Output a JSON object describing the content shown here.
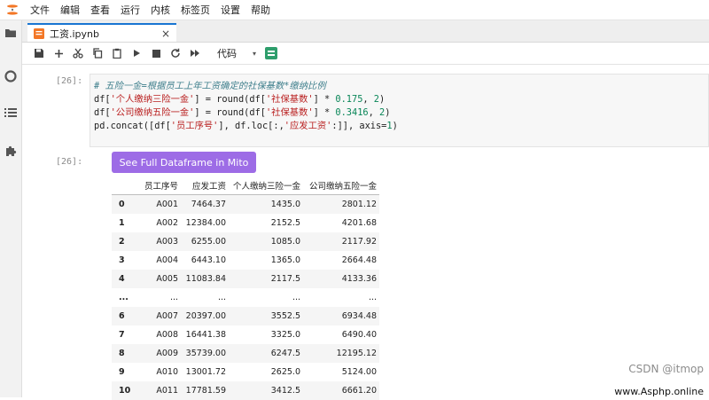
{
  "menu": [
    "文件",
    "编辑",
    "查看",
    "运行",
    "内核",
    "标签页",
    "设置",
    "帮助"
  ],
  "tab": {
    "label": "工资.ipynb",
    "close": "×"
  },
  "toolbar": {
    "cell_type": "代码",
    "caret": "▾"
  },
  "cells": {
    "code_prompt": "[26]:",
    "code_lines": {
      "l1": "# 五险一金=根据员工上年工资确定的社保基数*缴纳比例",
      "l2_a": "df[",
      "l2_s": "'个人缴纳三险一金'",
      "l2_b": "] = round(df[",
      "l2_s2": "'社保基数'",
      "l2_c": "] * ",
      "l2_n": "0.175",
      "l2_d": ", ",
      "l2_n2": "2",
      "l2_e": ")",
      "l3_a": "df[",
      "l3_s": "'公司缴纳五险一金'",
      "l3_b": "] = round(df[",
      "l3_s2": "'社保基数'",
      "l3_c": "] * ",
      "l3_n": "0.3416",
      "l3_d": ", ",
      "l3_n2": "2",
      "l3_e": ")",
      "l4_a": "pd.concat([df[",
      "l4_s": "'员工序号'",
      "l4_b": "], df.loc[:,",
      "l4_s2": "'应发工资'",
      "l4_c": ":]], axis=",
      "l4_n": "1",
      "l4_d": ")"
    },
    "output_prompt": "[26]:",
    "mito_button": "See Full Dataframe in Mito"
  },
  "table": {
    "headers": [
      "",
      "员工序号",
      "应发工资",
      "个人缴纳三险一金",
      "公司缴纳五险一金"
    ],
    "rows": [
      [
        "0",
        "A001",
        "7464.37",
        "1435.0",
        "2801.12"
      ],
      [
        "1",
        "A002",
        "12384.00",
        "2152.5",
        "4201.68"
      ],
      [
        "2",
        "A003",
        "6255.00",
        "1085.0",
        "2117.92"
      ],
      [
        "3",
        "A004",
        "6443.10",
        "1365.0",
        "2664.48"
      ],
      [
        "4",
        "A005",
        "11083.84",
        "2117.5",
        "4133.36"
      ],
      [
        "...",
        "...",
        "...",
        "...",
        "..."
      ],
      [
        "6",
        "A007",
        "20397.00",
        "3552.5",
        "6934.48"
      ],
      [
        "7",
        "A008",
        "16441.38",
        "3325.0",
        "6490.40"
      ],
      [
        "8",
        "A009",
        "35739.00",
        "6247.5",
        "12195.12"
      ],
      [
        "9",
        "A010",
        "13001.72",
        "2625.0",
        "5124.00"
      ],
      [
        "10",
        "A011",
        "17781.59",
        "3412.5",
        "6661.20"
      ]
    ]
  },
  "watermarks": {
    "csdn": "CSDN @itmop",
    "site": "www.Asphp.online"
  },
  "colors": {
    "accent": "#1976d2",
    "mito": "#9d6ce6",
    "format_icon": "#2e9e6c"
  }
}
